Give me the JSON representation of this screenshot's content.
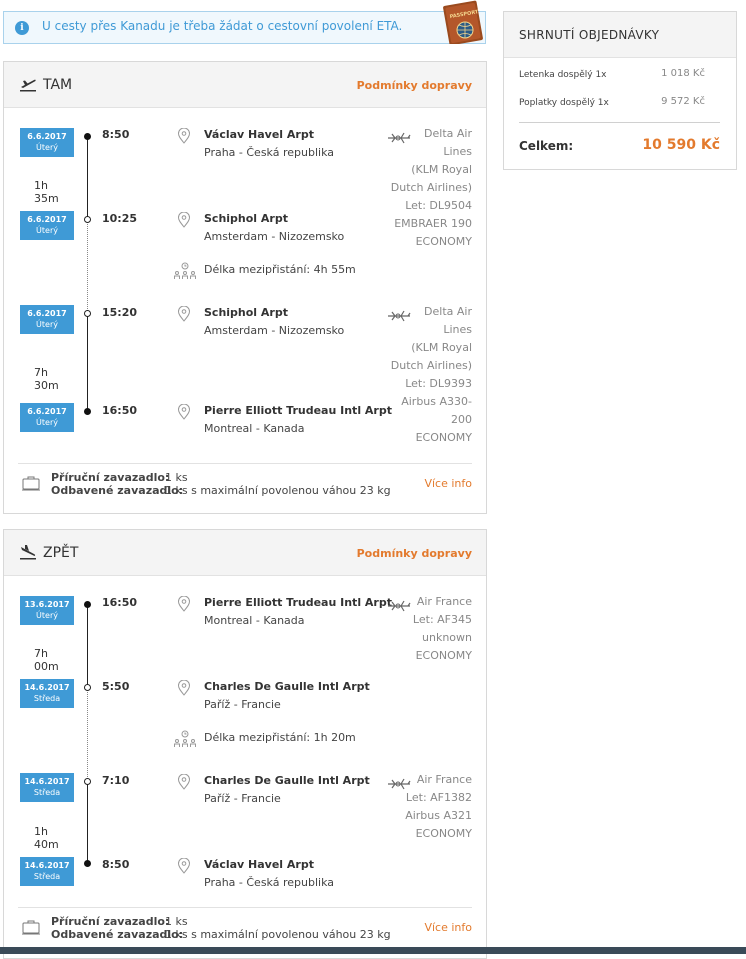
{
  "info": {
    "text": "U cesty přes Kanadu je třeba žádat o cestovní povolení ETA.",
    "passport_label": "PASSPORT"
  },
  "outbound": {
    "title": "TAM",
    "conditions_link": "Podmínky dopravy",
    "stops": [
      {
        "date": "6.6.2017",
        "day": "Úterý",
        "time": "8:50",
        "airport": "Václav Havel Arpt",
        "city": "Praha - Česká republika"
      },
      {
        "date": "6.6.2017",
        "day": "Úterý",
        "time": "10:25",
        "airport": "Schiphol Arpt",
        "city": "Amsterdam - Nizozemsko"
      },
      {
        "date": "6.6.2017",
        "day": "Úterý",
        "time": "15:20",
        "airport": "Schiphol Arpt",
        "city": "Amsterdam - Nizozemsko"
      },
      {
        "date": "6.6.2017",
        "day": "Úterý",
        "time": "16:50",
        "airport": "Pierre Elliott Trudeau Intl Arpt",
        "city": "Montreal - Kanada"
      }
    ],
    "segments": [
      {
        "duration": "1h 35m",
        "carrier_lines": [
          "Delta Air",
          "Lines",
          "(KLM Royal",
          "Dutch Airlines)",
          "Let: DL9504",
          "EMBRAER 190",
          "ECONOMY"
        ]
      },
      {
        "duration": "7h 30m",
        "carrier_lines": [
          "Delta Air",
          "Lines",
          "(KLM Royal",
          "Dutch Airlines)",
          "Let: DL9393",
          "Airbus A330-",
          "200",
          "ECONOMY"
        ]
      }
    ],
    "layover": "Délka mezipřistání: 4h 55m",
    "baggage": {
      "cabin_label": "Příruční zavazadlo:",
      "cabin_value": "1 ks",
      "checked_label": "Odbavené zavazadlo:",
      "checked_value": "1 ks s maximální povolenou váhou 23 kg",
      "more_link": "Více info"
    }
  },
  "inbound": {
    "title": "ZPĚT",
    "conditions_link": "Podmínky dopravy",
    "stops": [
      {
        "date": "13.6.2017",
        "day": "Úterý",
        "time": "16:50",
        "airport": "Pierre Elliott Trudeau Intl Arpt",
        "city": "Montreal - Kanada"
      },
      {
        "date": "14.6.2017",
        "day": "Středa",
        "time": "5:50",
        "airport": "Charles De Gaulle Intl Arpt",
        "city": "Paříž - Francie"
      },
      {
        "date": "14.6.2017",
        "day": "Středa",
        "time": "7:10",
        "airport": "Charles De Gaulle Intl Arpt",
        "city": "Paříž - Francie"
      },
      {
        "date": "14.6.2017",
        "day": "Středa",
        "time": "8:50",
        "airport": "Václav Havel Arpt",
        "city": "Praha - Česká republika"
      }
    ],
    "segments": [
      {
        "duration": "7h 00m",
        "carrier_lines": [
          "Air France",
          "Let: AF345",
          "unknown",
          "ECONOMY"
        ]
      },
      {
        "duration": "1h 40m",
        "carrier_lines": [
          "Air France",
          "Let: AF1382",
          "Airbus A321",
          "ECONOMY"
        ]
      }
    ],
    "layover": "Délka mezipřistání: 1h 20m",
    "baggage": {
      "cabin_label": "Příruční zavazadlo:",
      "cabin_value": "1 ks",
      "checked_label": "Odbavené zavazadlo:",
      "checked_value": "1 ks s maximální povolenou váhou 23 kg",
      "more_link": "Více info"
    }
  },
  "summary": {
    "title": "SHRNUTÍ OBJEDNÁVKY",
    "rows": [
      {
        "label": "Letenka dospělý 1x",
        "value": "1 018 Kč"
      },
      {
        "label": "Poplatky dospělý 1x",
        "value": "9 572 Kč"
      }
    ],
    "total_label": "Celkem:",
    "total_value": "10 590 Kč"
  },
  "colors": {
    "accent": "#e37a2d",
    "badge": "#3f9ad6",
    "info_border": "#a9d2ec"
  }
}
